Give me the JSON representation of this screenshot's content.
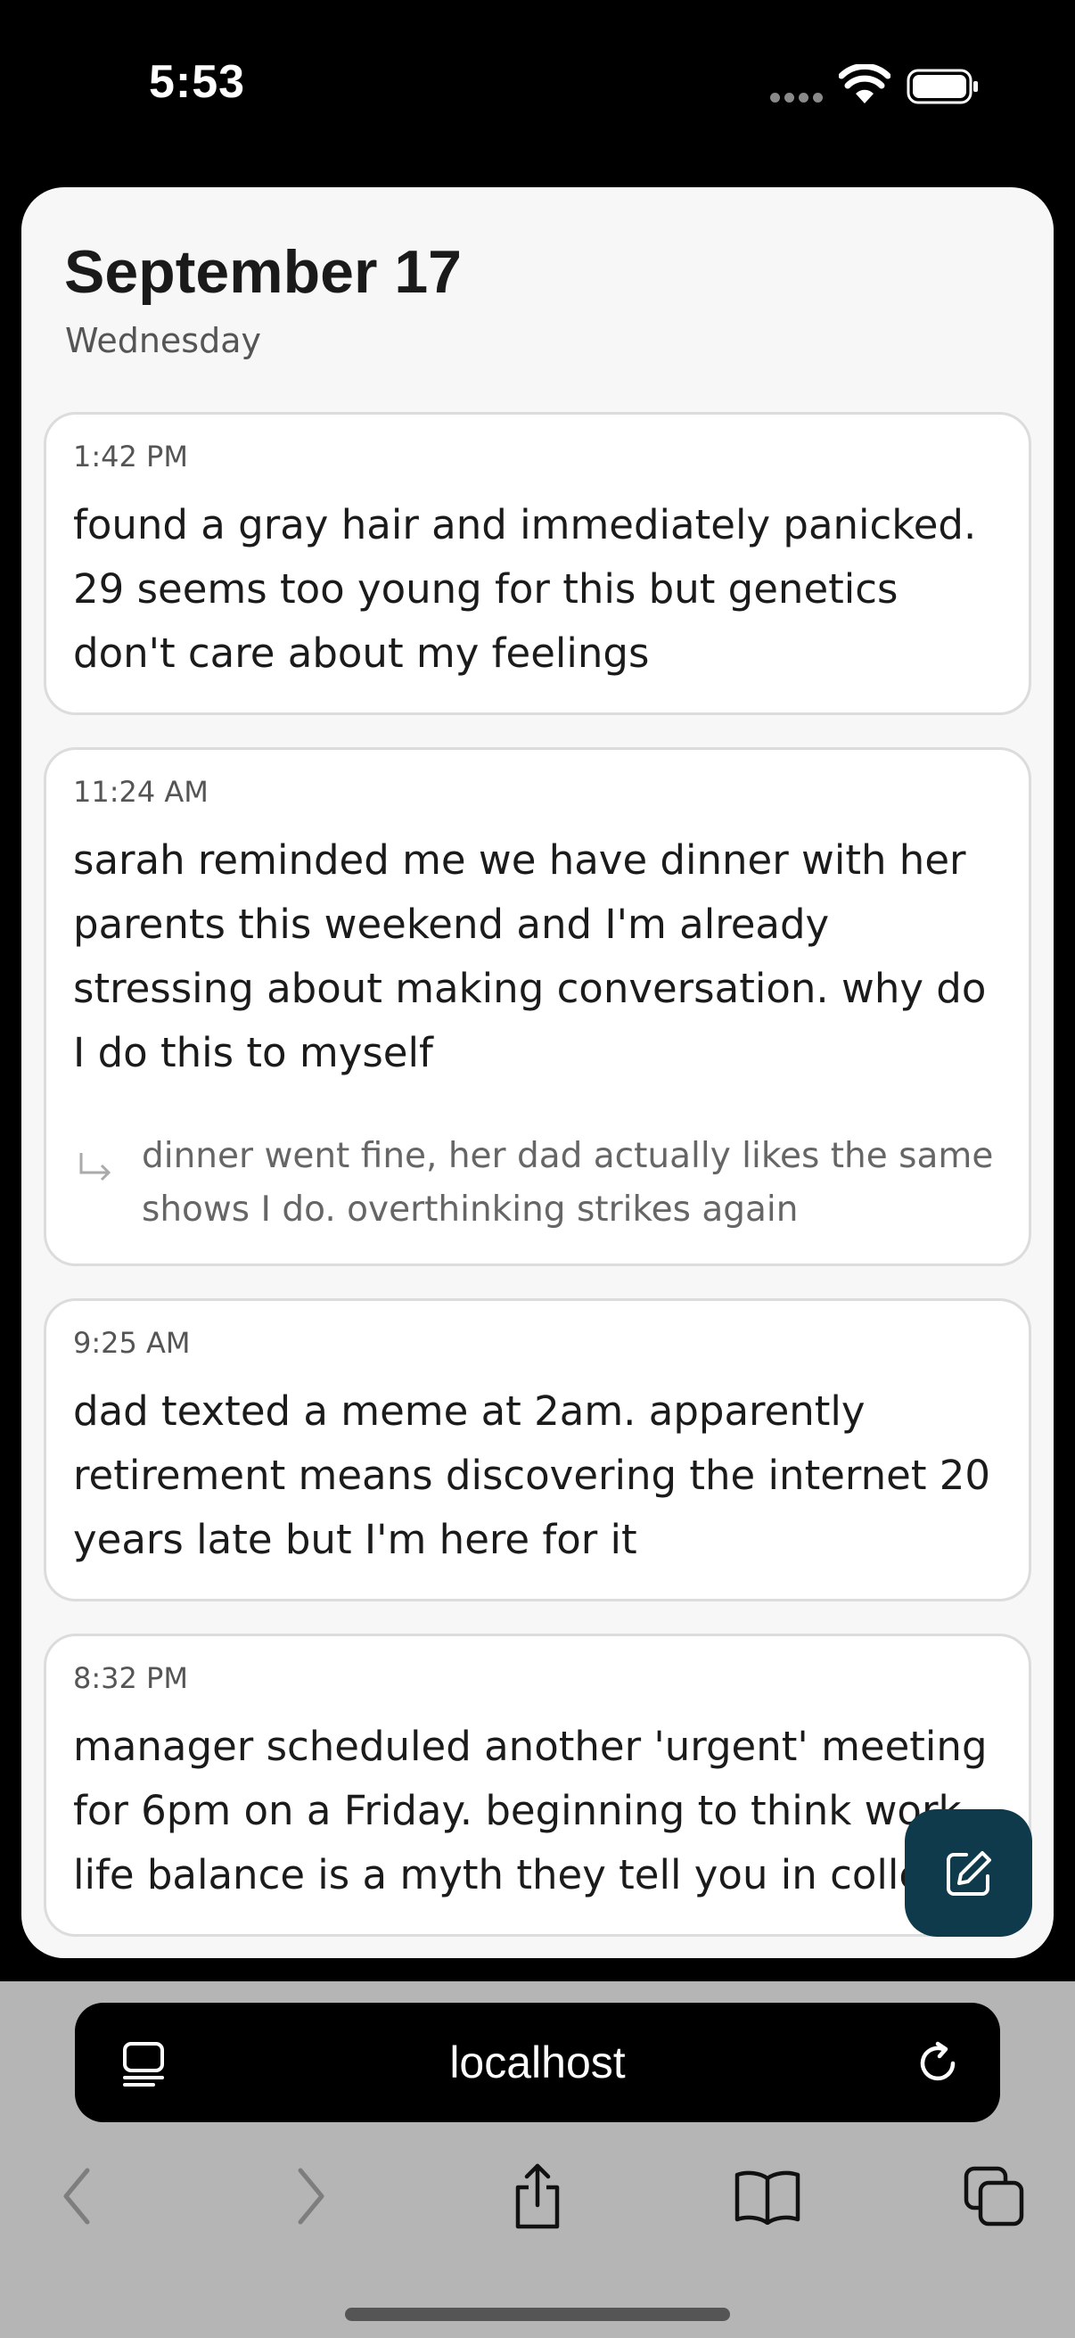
{
  "status": {
    "time": "5:53"
  },
  "header": {
    "title": "September 17",
    "subtitle": "Wednesday"
  },
  "entries": [
    {
      "time": "1:42 PM",
      "text": "found a gray hair and immediately panicked. 29 seems too young for this but genetics don't care about my feelings"
    },
    {
      "time": "11:24 AM",
      "text": "sarah reminded me we have dinner with her parents this weekend and I'm already stressing about making conversation. why do I do this to myself",
      "followup": "dinner went fine, her dad actually likes the same shows I do. overthinking strikes again"
    },
    {
      "time": "9:25 AM",
      "text": "dad texted a meme at 2am. apparently retirement means discovering the internet 20 years late but I'm here for it"
    },
    {
      "time": "8:32 PM",
      "text": "manager scheduled another 'urgent' meeting for 6pm on a Friday. beginning to think work-life balance is a myth they tell you in college"
    }
  ],
  "compose": {
    "icon": "edit-icon",
    "color": "#0f3a4c"
  },
  "browser": {
    "url": "localhost",
    "toolbar_icons": [
      "back-icon",
      "forward-icon",
      "share-icon",
      "bookmarks-icon",
      "tabs-icon"
    ]
  }
}
